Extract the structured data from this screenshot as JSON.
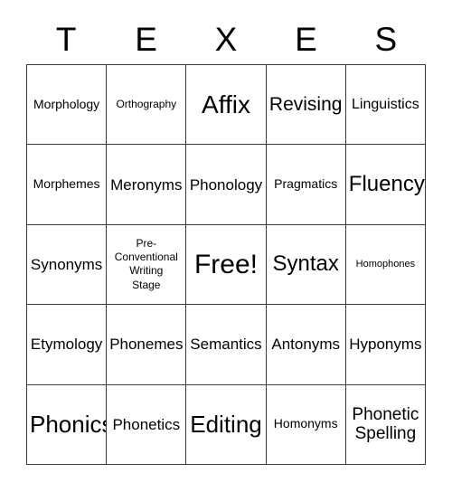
{
  "card": {
    "title_letters": [
      "T",
      "E",
      "X",
      "E",
      "S"
    ],
    "columns": 5,
    "rows": 5,
    "free_space_label": "Free!",
    "border_color": "#3a3a3a",
    "background_color": "#ffffff",
    "text_color": "#000000"
  },
  "cells": [
    {
      "text": "Morphology",
      "size": "fs-s"
    },
    {
      "text": "Orthography",
      "size": "fs-xs"
    },
    {
      "text": "Affix",
      "size": "fs-4xl"
    },
    {
      "text": "Revising",
      "size": "fs-xl"
    },
    {
      "text": "Linguistics",
      "size": "fs-m"
    },
    {
      "text": "Morphemes",
      "size": "fs-s"
    },
    {
      "text": "Meronyms",
      "size": "fs-ml"
    },
    {
      "text": "Phonology",
      "size": "fs-ml"
    },
    {
      "text": "Pragmatics",
      "size": "fs-s"
    },
    {
      "text": "Fluency",
      "size": "fs-2xl"
    },
    {
      "text": "Synonyms",
      "size": "fs-ml"
    },
    {
      "text": "Pre-\nConventional\nWriting\nStage",
      "size": "fs-xs"
    },
    {
      "text": "Free!",
      "size": "fs-5xl"
    },
    {
      "text": "Syntax",
      "size": "fs-2xl"
    },
    {
      "text": "Homophones",
      "size": "fs-xxs"
    },
    {
      "text": "Etymology",
      "size": "fs-ml"
    },
    {
      "text": "Phonemes",
      "size": "fs-ml"
    },
    {
      "text": "Semantics",
      "size": "fs-ml"
    },
    {
      "text": "Antonyms",
      "size": "fs-ml"
    },
    {
      "text": "Hyponyms",
      "size": "fs-ml"
    },
    {
      "text": "Phonics",
      "size": "fs-3xl"
    },
    {
      "text": "Phonetics",
      "size": "fs-ml"
    },
    {
      "text": "Editing",
      "size": "fs-3xl"
    },
    {
      "text": "Homonyms",
      "size": "fs-s"
    },
    {
      "text": "Phonetic\nSpelling",
      "size": "fs-l"
    }
  ]
}
